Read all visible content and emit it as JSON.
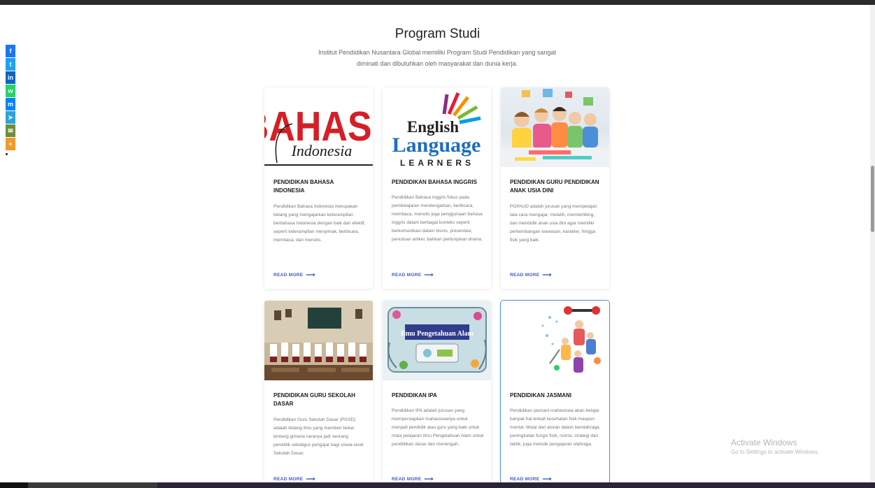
{
  "header": {
    "title": "Program Studi",
    "subtitle": "Institut Pendidikan Nusantara Global memiliki Program Studi Pendidikan yang sangat diminati dan dibutuhkan oleh masyarakat dan dunia kerja."
  },
  "share_bar": [
    {
      "name": "facebook",
      "glyph": "f",
      "color": "#1877f2"
    },
    {
      "name": "twitter",
      "glyph": "t",
      "color": "#1da1f2"
    },
    {
      "name": "linkedin",
      "glyph": "in",
      "color": "#0a66c2"
    },
    {
      "name": "whatsapp",
      "glyph": "w",
      "color": "#25d366"
    },
    {
      "name": "messenger",
      "glyph": "m",
      "color": "#0084ff"
    },
    {
      "name": "telegram",
      "glyph": "➤",
      "color": "#2aa3df"
    },
    {
      "name": "email",
      "glyph": "✉",
      "color": "#6b8e3a"
    },
    {
      "name": "more",
      "glyph": "+",
      "color": "#f29a28"
    }
  ],
  "cards": [
    {
      "title": "PENDIDIKAN BAHASA INDONESIA",
      "desc": "Pendidikan Bahasa Indonesia merupakan bidang yang mengajarkan keterampilan berbahasa Indonesia dengan baik dan efektif, seperti keterampilan menyimak, berbicara, membaca, dan menulis.",
      "more": "READ MORE",
      "image": {
        "word1": "BAHASA",
        "word2": "Indonesia"
      }
    },
    {
      "title": "PENDIDIKAN BAHASA INGGRIS",
      "desc": "Pendidikan Bahasa Inggris fokus pada pembelajaran mendengarkan, berbicara, membaca, menulis juga penggunaan bahasa Inggris dalam berbagai konteks seperti berkomunikasi dalam bisnis, presentasi, penulisan artikel, bahkan pertunjukan drama.",
      "more": "READ MORE",
      "image": {
        "word1": "English",
        "word2": "Language",
        "word3": "LEARNERS"
      }
    },
    {
      "title": "PENDIDIKAN GURU PENDIDIKAN ANAK USIA DINI",
      "desc": "PGPAUD adalah jurusan yang mempelajari tata cara mengajar, melatih, membimbing, dan mendidik anak usia dini agar memiliki perkembangan wawasan, karakter, hingga fisik yang baik.",
      "more": "READ MORE",
      "image": {}
    },
    {
      "title": "PENDIDIKAN GURU SEKOLAH DASAR",
      "desc": "Pendidikan Guru Sekolah Dasar (PGSD) adalah bidang ilmu yang memberi bekal tentang gimana caranya jadi seorang pendidik sekaligus pengajar bagi siswa-siswi Sekolah Dasar.",
      "more": "READ MORE",
      "image": {}
    },
    {
      "title": "PENDIDIKAN IPA",
      "desc": "Pendidikan IPA adalah jurusan yang mempersiapkan mahasiswanya untuk menjadi pendidik atau guru yang baik untuk mata pelajaran Ilmu Pengetahuan Alam untuk pendidikan dasar dan menengah.",
      "more": "READ MORE",
      "image": {
        "word1": "Ilmu Pengetahuan Alam"
      }
    },
    {
      "title": "PENDIDIKAN JASMANI",
      "desc": "Pendidikan jasmani mahasiswa akan belajar banyak hal terkait kesehatan fisik maupun mental. Mulai dari aturan dalam berolahraga, peningkatan fungsi fisik, nutrisi, strategi dan taktik, juga metode pengajaran olahraga.",
      "more": "READ MORE",
      "image": {}
    }
  ],
  "os_watermark": {
    "line1": "Activate Windows",
    "line2": "Go to Settings to activate Windows."
  }
}
